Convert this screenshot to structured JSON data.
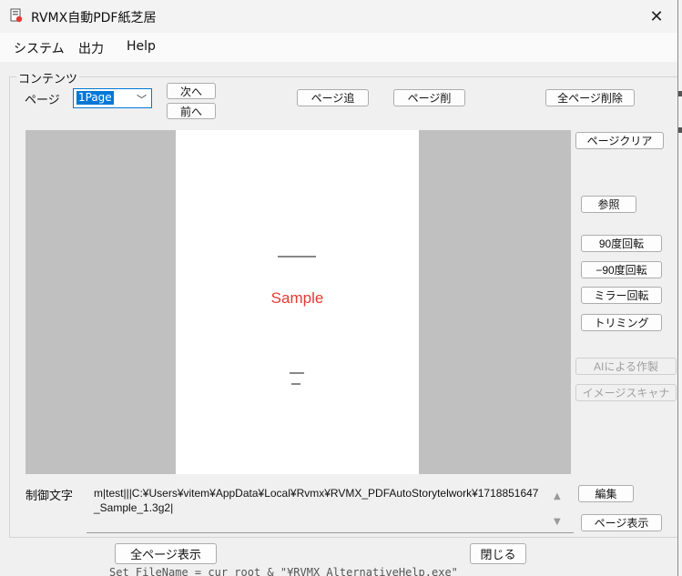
{
  "window": {
    "title": "RVMX自動PDF紙芝居",
    "close_label": "✕"
  },
  "menu": {
    "items": [
      "システム",
      "出力",
      "Help"
    ]
  },
  "contents": {
    "group_label": "コンテンツ",
    "page_label": "ページ",
    "page_select_value": "1Page",
    "next_button": "次へ",
    "prev_button": "前へ",
    "page_add_button": "ページ追",
    "page_delete_button": "ページ削",
    "delete_all_button": "全ページ削除"
  },
  "side_buttons": {
    "page_clear": "ページクリア",
    "browse": "参照",
    "rotate90": "90度回転",
    "rotate_minus90": "−90度回転",
    "mirror_rotate": "ミラー回転",
    "trimming": "トリミング",
    "ai_create": "AIによる作製",
    "image_scanner": "イメージスキャナ"
  },
  "preview": {
    "sample_text": "Sample",
    "sample_color": "#e53935"
  },
  "control": {
    "label": "制御文字",
    "text": "m|test|||C:¥Users¥vitem¥AppData¥Local¥Rvmx¥RVMX_PDFAutoStorytelwork¥1718851647_Sample_1.3g2|",
    "edit_button": "編集",
    "page_show_button": "ページ表示"
  },
  "footer": {
    "show_all_button": "全ページ表示",
    "close_button": "閉じる"
  },
  "background_text": "Set FileName = cur_root & \"¥RVMX_AlternativeHelp.exe\""
}
